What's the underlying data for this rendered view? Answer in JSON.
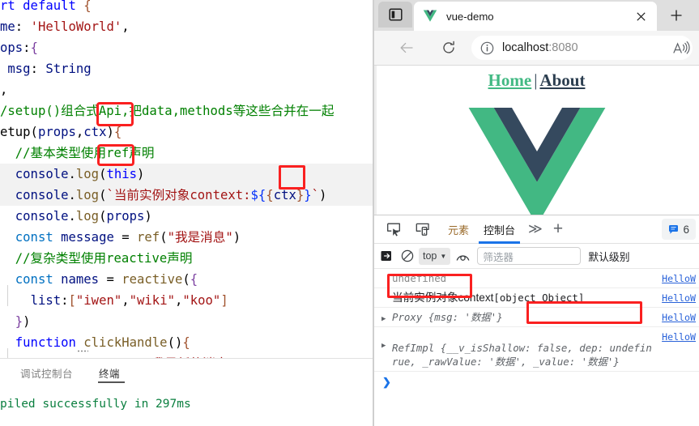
{
  "editor": {
    "lines": [
      {
        "text": "rt default {"
      },
      {
        "text": "me: 'HelloWorld',"
      },
      {
        "text": "ops:{"
      },
      {
        "text": " msg: String"
      },
      {
        "text": ","
      },
      {
        "text": "/setup()组合式Api,把data,methods等这些合并在一起"
      },
      {
        "text": "etup(props,ctx){"
      },
      {
        "text": "  //基本类型使用ref声明"
      },
      {
        "text": "  console.log(this)"
      },
      {
        "text": "  console.log(`当前实例对象context:${{ctx}}`)"
      },
      {
        "text": "  console.log(props)"
      },
      {
        "text": "  const message = ref(\"我是消息\")"
      },
      {
        "text": "  //复杂类型使用reactive声明"
      },
      {
        "text": "  const names = reactive({"
      },
      {
        "text": "    list:[\"iwen\",\"wiki\",\"koo\"]"
      },
      {
        "text": "  })"
      },
      {
        "text": "  function clickHandle(){"
      },
      {
        "text": "    this.message = \"我是新的消息\""
      },
      {
        "text": "  }"
      }
    ]
  },
  "panel": {
    "tabs": [
      {
        "label": "调试控制台",
        "active": false
      },
      {
        "label": "终端",
        "active": true
      }
    ],
    "terminal_output": "piled successfully in 297ms"
  },
  "browser": {
    "sidebar_button_name": "sidebar-toggle",
    "tab": {
      "title": "vue-demo",
      "favicon": "vue-logo-icon",
      "close_label": "×"
    },
    "new_tab_label": "+",
    "nav": {
      "back_label": "←",
      "reload_label": "⟳"
    },
    "omnibox": {
      "info_icon": "info-circle-icon",
      "url_host": "localhost",
      "url_port": ":8080",
      "read_aloud_icon": "read-aloud-icon"
    }
  },
  "page": {
    "nav_home": "Home",
    "nav_separator": "|",
    "nav_about": "About",
    "logo_name": "vue-logo",
    "colors": {
      "vue_green": "#42b883",
      "vue_dark": "#35495e",
      "link_green": "#42b983",
      "link_dark": "#2c3e50"
    }
  },
  "devtools": {
    "inspect_icon": "inspect-element-icon",
    "device_icon": "device-toolbar-icon",
    "tabs": [
      {
        "label": "元素",
        "active": false
      },
      {
        "label": "控制台",
        "active": true
      }
    ],
    "more_tabs_label": "≫",
    "add_tab_label": "+",
    "badge": {
      "icon": "message-icon",
      "count": "6"
    },
    "filterbar": {
      "clear_icon": "clear-console-icon",
      "no_entry_icon": "no-entry-icon",
      "context": "top",
      "chevron": "▼",
      "eye_icon": "live-expression-icon",
      "filter_placeholder": "筛选器",
      "level": "默认级别"
    },
    "console_rows": [
      {
        "kind": "plain",
        "text": "undefined",
        "style": "undefined",
        "source": "HelloW",
        "expandable": false
      },
      {
        "kind": "mixed",
        "text_cn": "当前实例对象context",
        "text_mono": "[object Object]",
        "source": "HelloW",
        "expandable": false
      },
      {
        "kind": "object",
        "name": "Proxy",
        "preview": "{msg: '数据'}",
        "source": "HelloW",
        "expandable": true
      },
      {
        "kind": "object-multiline",
        "name": "RefImpl",
        "line1": "{__v_isShallow: false, dep: undefin",
        "line2": "rue, _rawValue: '数据', _value: '数据'}",
        "source": "HelloW",
        "expandable": true
      }
    ],
    "prompt": "❯"
  },
  "annotations": {
    "color": "#fa2020",
    "boxes": [
      {
        "name": "ctx-param-highlight"
      },
      {
        "name": "this-highlight"
      },
      {
        "name": "ctx-template-highlight"
      },
      {
        "name": "undefined-output-highlight"
      },
      {
        "name": "object-object-output-highlight"
      }
    ]
  }
}
